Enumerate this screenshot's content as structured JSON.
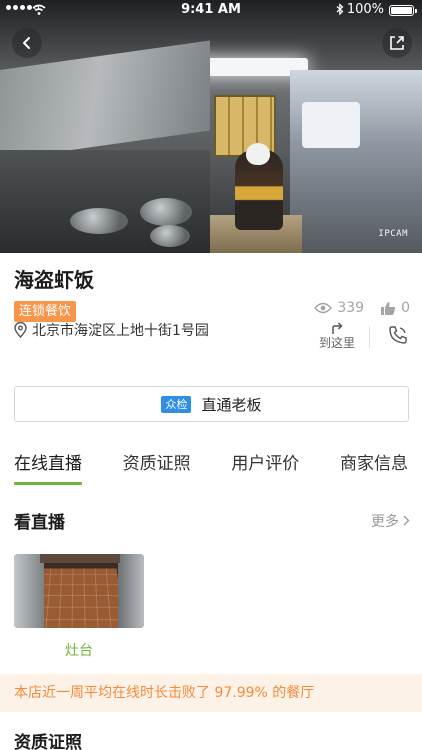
{
  "status_bar": {
    "time": "9:41 AM",
    "battery": "100%"
  },
  "video": {
    "watermark": "IPCAM"
  },
  "store": {
    "name": "海盗虾饭",
    "tag": "连锁餐饮",
    "address": "北京市海淀区上地十街1号园",
    "views": "339",
    "likes": "0",
    "goto_label": "到这里"
  },
  "direct_boss": {
    "badge": "众检",
    "label": "直通老板"
  },
  "tabs": [
    {
      "label": "在线直播",
      "active": true
    },
    {
      "label": "资质证照",
      "active": false
    },
    {
      "label": "用户评价",
      "active": false
    },
    {
      "label": "商家信息",
      "active": false
    }
  ],
  "live_section": {
    "title": "看直播",
    "more": "更多"
  },
  "live_items": [
    {
      "label": "灶台"
    }
  ],
  "notice": "本店近一周平均在线时长击败了 97.99% 的餐厅",
  "next_section": {
    "title": "资质证照"
  },
  "colors": {
    "accent": "#73b33d",
    "tag": "#f7954b",
    "notice_text": "#f58b3a",
    "notice_bg": "#fdf2e8",
    "badge": "#2f8ee5"
  }
}
